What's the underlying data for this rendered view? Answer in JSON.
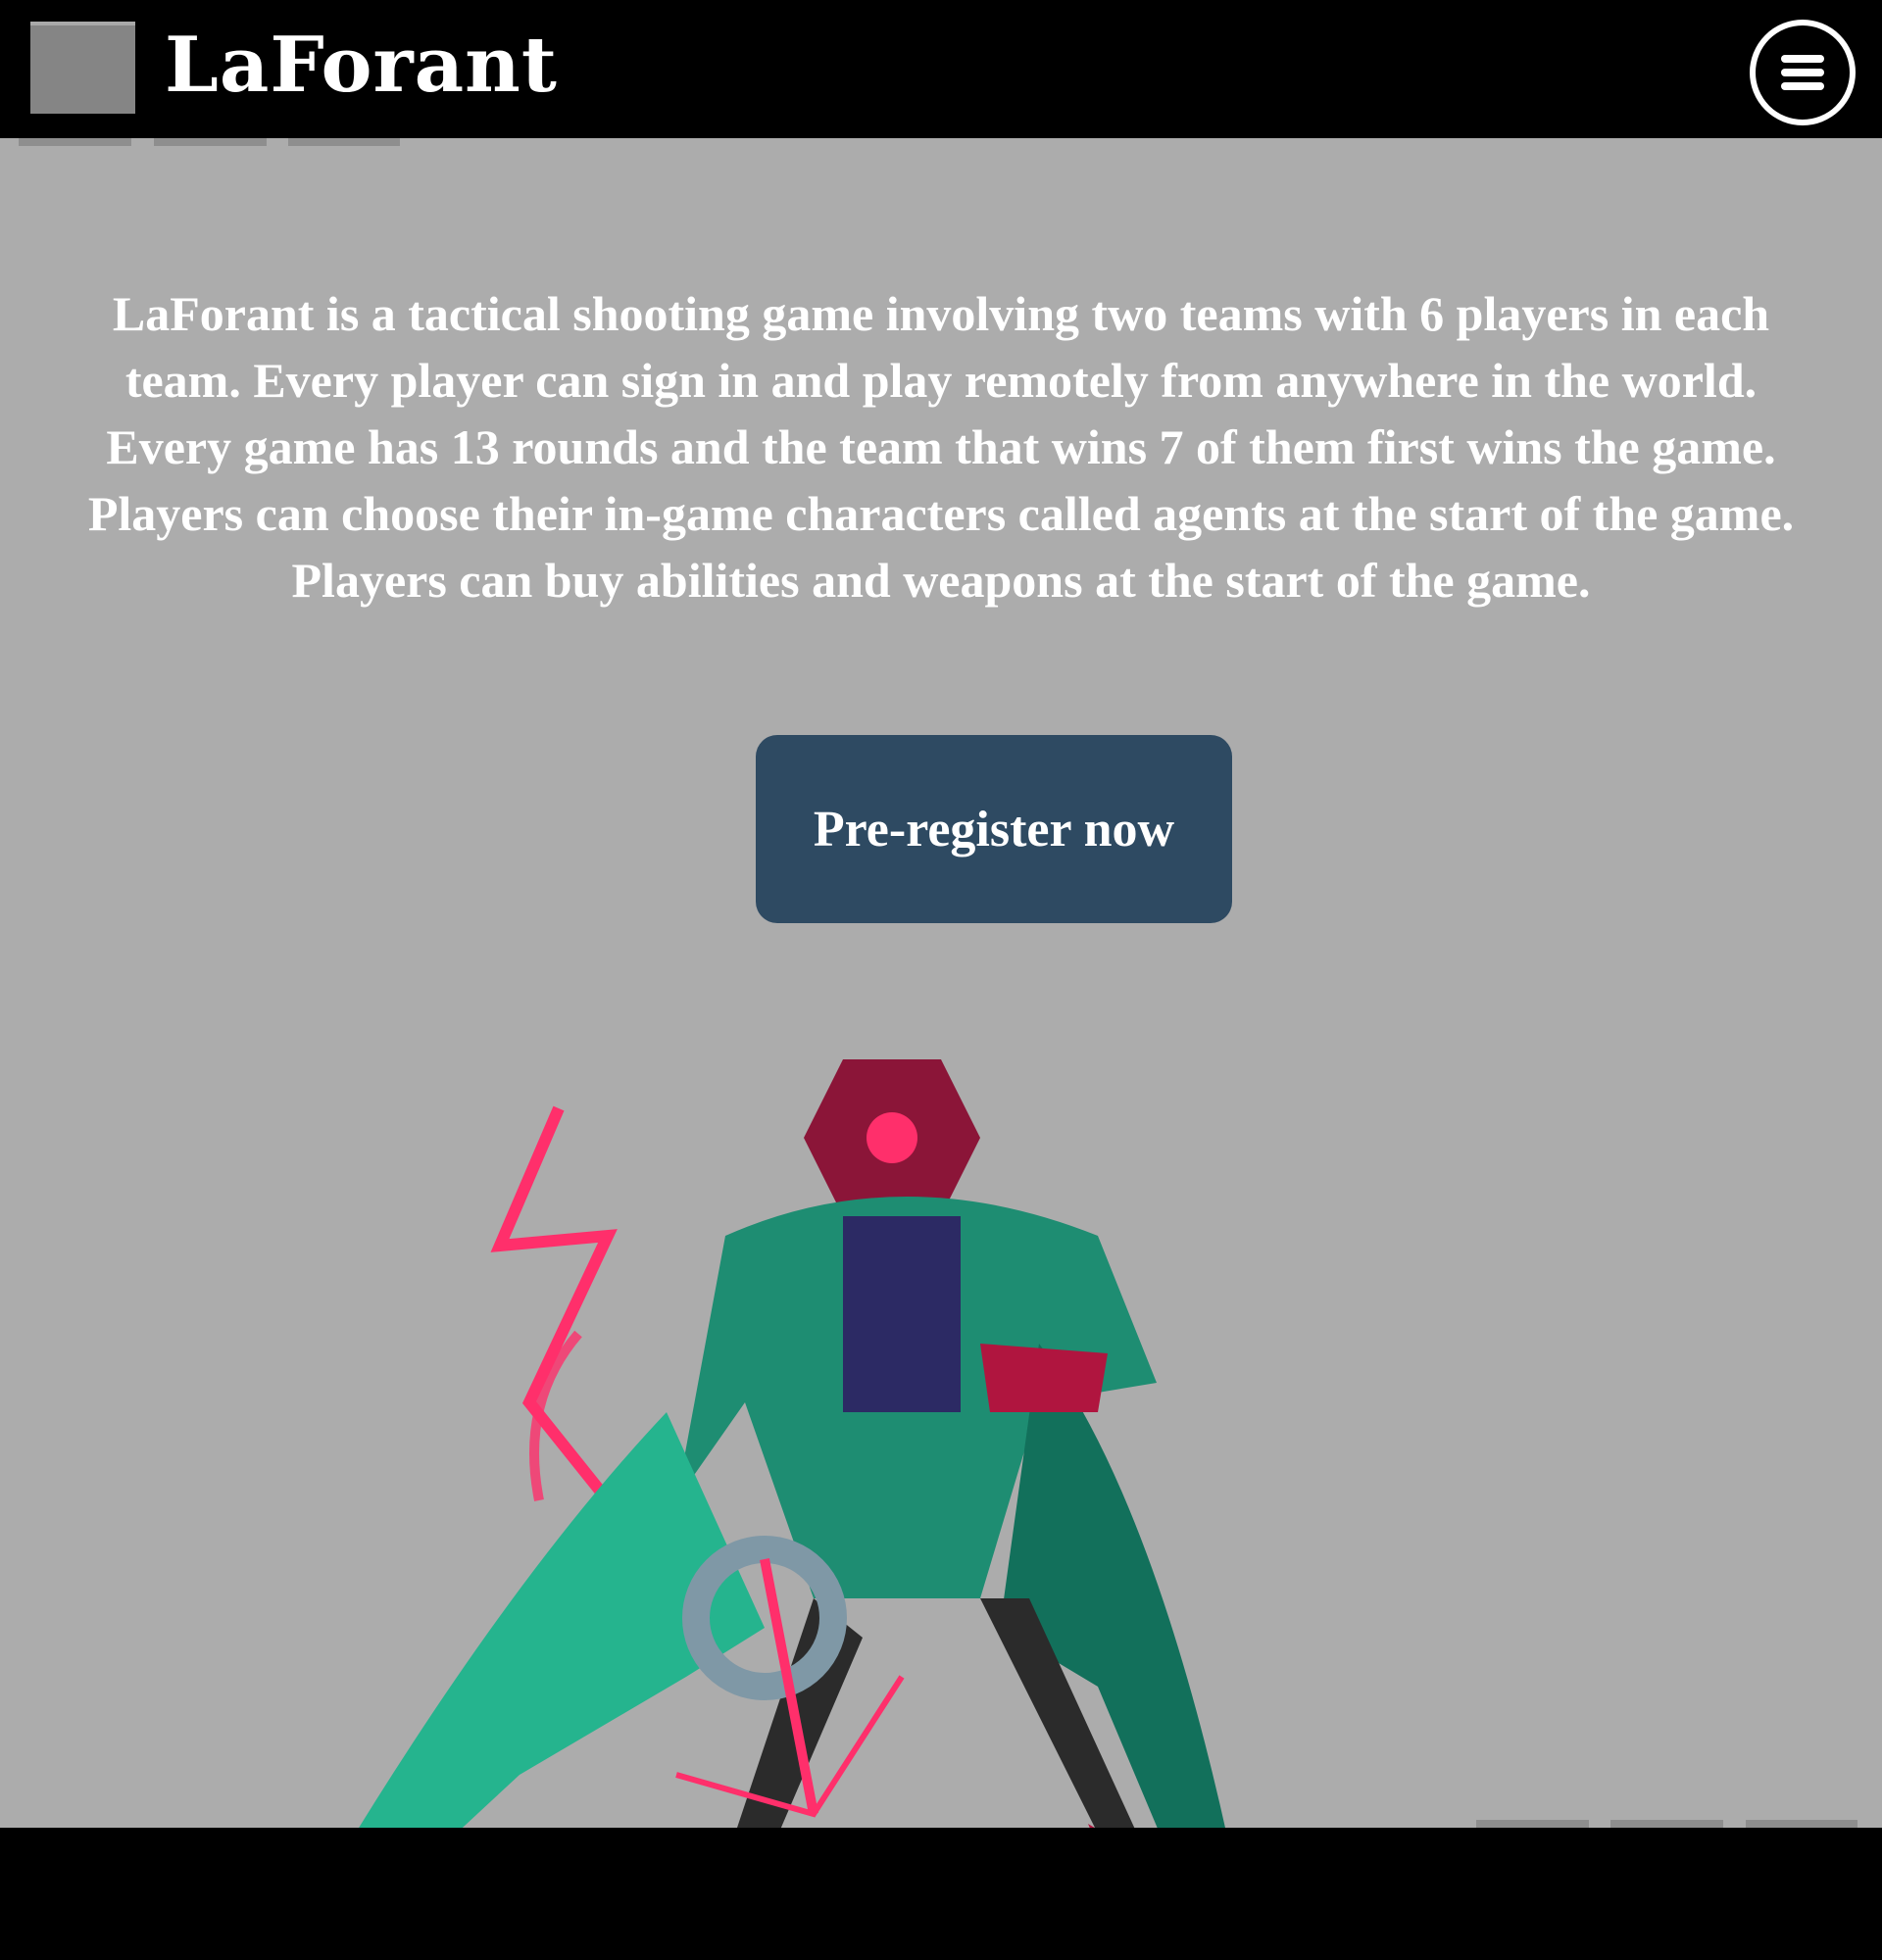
{
  "header": {
    "brand": "LaForant",
    "logo_icon": "logo-placeholder-icon",
    "menu_icon": "hamburger-menu-icon"
  },
  "main": {
    "intro": "LaForant is a tactical shooting game involving two teams with 6 players in each team. Every player can sign in and play remotely from anywhere in the world. Every game has 13 rounds and the team that wins 7 of them first wins the game. Players can choose their in-game characters called agents at the start of the game. Players can buy abilities and weapons at the start of the game.",
    "cta_label": "Pre-register now",
    "hero_icon": "agent-character-illustration"
  },
  "colors": {
    "header_bg": "#000000",
    "page_bg": "#acacac",
    "button_bg": "#2e4a62",
    "text": "#ffffff"
  }
}
